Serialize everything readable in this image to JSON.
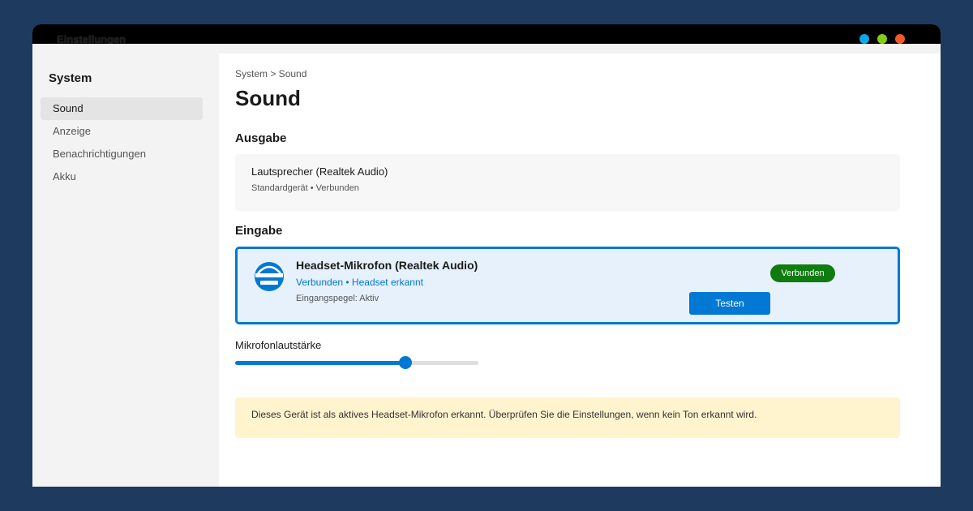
{
  "window": {
    "title": "Einstellungen",
    "dot_colors": [
      "#0ea5e9",
      "#84cc16",
      "#f05a28"
    ]
  },
  "sidebar": {
    "heading": "System",
    "items": [
      {
        "label": "Sound",
        "active": true
      },
      {
        "label": "Anzeige",
        "active": false
      },
      {
        "label": "Benachrichtigungen",
        "active": false
      },
      {
        "label": "Akku",
        "active": false
      }
    ]
  },
  "main": {
    "breadcrumb": "System > Sound",
    "title": "Sound",
    "output": {
      "section_title": "Ausgabe",
      "device_name": "Lautsprecher (Realtek Audio)",
      "device_status": "Standardgerät • Verbunden"
    },
    "input": {
      "section_title": "Eingabe",
      "device_icon": "headset-icon",
      "device_name": "Headset-Mikrofon (Realtek Audio)",
      "device_status": "Verbunden • Headset erkannt",
      "level": "Eingangspegel: Aktiv",
      "badge": "Verbunden",
      "test_button": "Testen"
    },
    "mic_volume": {
      "label": "Mikrofonlautstärke",
      "value_percent": 70
    },
    "notice": "Dieses Gerät ist als aktives Headset-Mikrofon erkannt. Überprüfen Sie die Einstellungen, wenn kein Ton erkannt wird."
  },
  "colors": {
    "accent": "#0078d4",
    "success": "#107c10",
    "notice_bg": "#fff4ce",
    "desktop": "#1e3a5f"
  }
}
